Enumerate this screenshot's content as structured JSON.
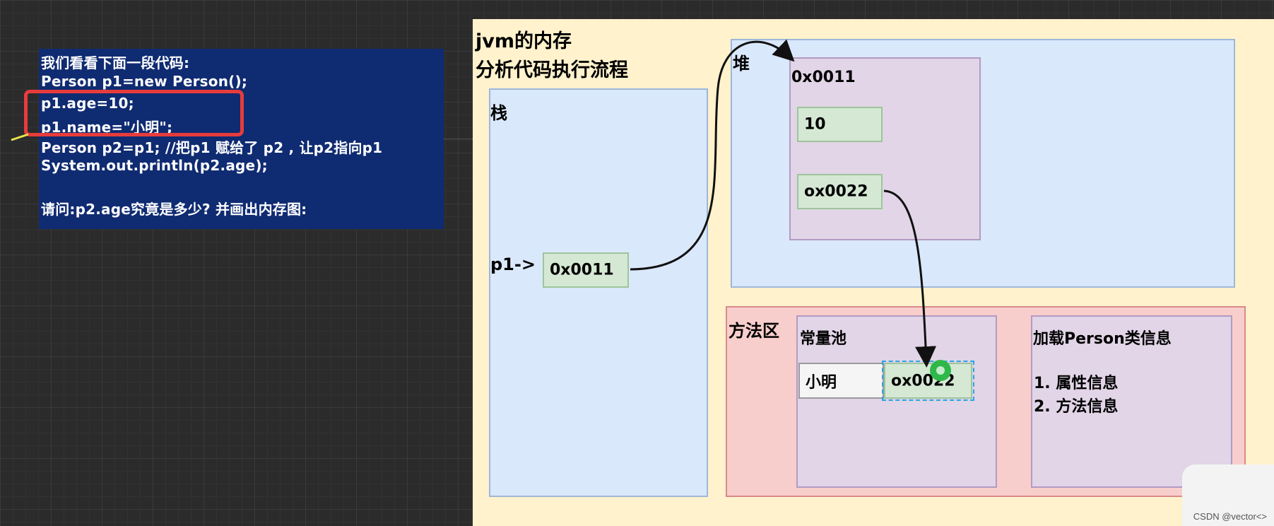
{
  "code": {
    "lines": [
      "我们看看下面一段代码:",
      "Person p1=new Person();",
      "p1.age=10;",
      "p1.name=\"小明\";",
      "Person p2=p1; //把p1 赋给了 p2 ,   让p2指向p1",
      "System.out.println(p2.age);",
      "",
      "请问:p2.age究竟是多少? 并画出内存图:"
    ],
    "highlight_color": "#e83c3c"
  },
  "jvm": {
    "title_line1": "jvm的内存",
    "title_line2": "分析代码执行流程",
    "stack": {
      "label": "栈",
      "pointer_label": "p1->",
      "p1_value": "0x0011"
    },
    "heap": {
      "label": "堆",
      "object_address": "0x0011",
      "age_value": "10",
      "name_ref": "ox0022"
    },
    "method_area": {
      "label": "方法区",
      "constant_pool": {
        "label": "常量池",
        "string_value": "小明",
        "string_address": "ox0022"
      },
      "class_info": {
        "title": "加载Person类信息",
        "item1": "1. 属性信息",
        "item2": "2. 方法信息"
      }
    }
  },
  "colors": {
    "background": "#2b2b2b",
    "code_panel": "#0f2b72",
    "jvm_area": "#fff2cc",
    "blue_region": "#dae8fc",
    "purple_region": "#e1d5e7",
    "pink_region": "#f8cecc",
    "green_cell": "#d5e8d4"
  },
  "watermark": "CSDN @vector<>"
}
